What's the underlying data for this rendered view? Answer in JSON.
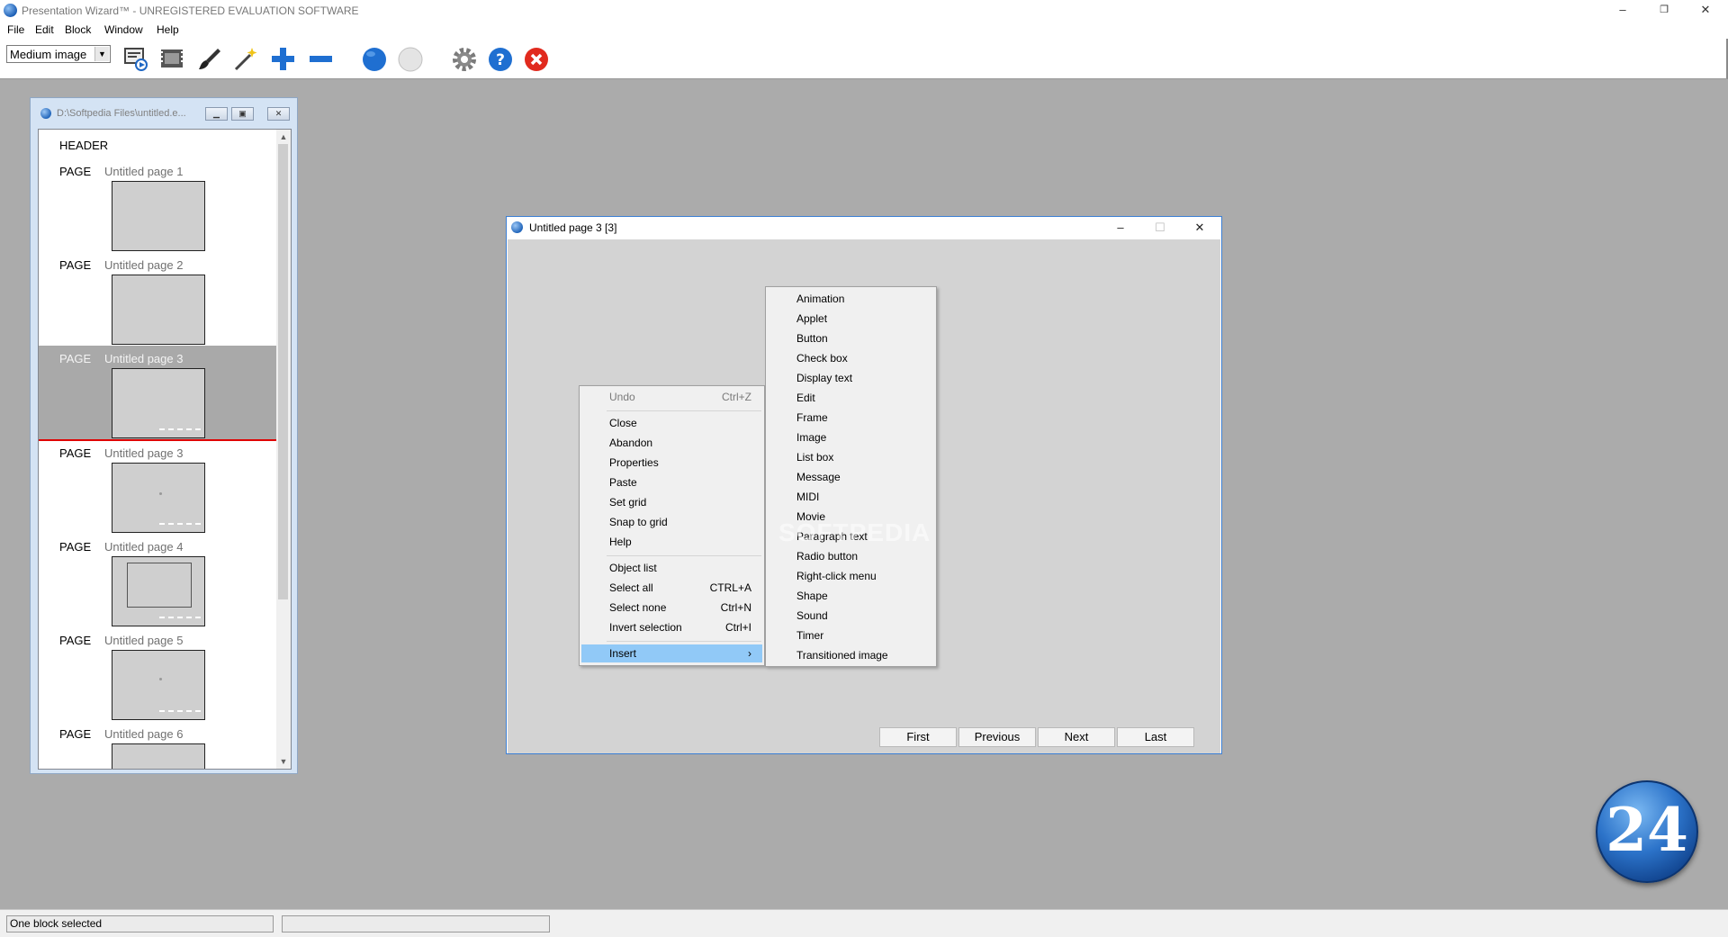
{
  "app": {
    "title": "Presentation Wizard™ - UNREGISTERED EVALUATION SOFTWARE",
    "window_controls": {
      "minimize": "–",
      "restore": "❐",
      "close": "✕"
    }
  },
  "menubar": [
    "File",
    "Edit",
    "Block",
    "Window",
    "Help"
  ],
  "toolbar": {
    "image_size_select": "Medium image",
    "buttons": [
      "slideshow-icon",
      "filmstrip-icon",
      "brush-icon",
      "magic-wand-icon",
      "plus-icon",
      "minus-icon",
      "blue-circle-icon",
      "white-circle-icon",
      "gear-icon",
      "help-icon",
      "close-icon"
    ]
  },
  "document_window": {
    "title": "D:\\Softpedia Files\\untitled.e...",
    "header_label": "HEADER",
    "page_label": "PAGE",
    "pages": [
      {
        "title": "Untitled page 1",
        "thumb": "photo-leaves"
      },
      {
        "title": "Untitled page 2",
        "thumb": "photo-frost"
      },
      {
        "title": "Untitled page 3",
        "thumb": "blank",
        "selected": true
      },
      {
        "title": "Untitled page 3",
        "thumb": "dot"
      },
      {
        "title": "Untitled page 4",
        "thumb": "frame"
      },
      {
        "title": "Untitled page 5",
        "thumb": "dot"
      },
      {
        "title": "Untitled page 6",
        "thumb": "dot"
      }
    ]
  },
  "page_window": {
    "title": "Untitled page 3   [3]",
    "nav_buttons": [
      "First",
      "Previous",
      "Next",
      "Last"
    ]
  },
  "context_menu": [
    {
      "label": "Undo",
      "shortcut": "Ctrl+Z",
      "disabled": true
    },
    {
      "label": "Close"
    },
    {
      "label": "Abandon"
    },
    {
      "label": "Properties"
    },
    {
      "label": "Paste"
    },
    {
      "label": "Set grid"
    },
    {
      "label": "Snap to grid"
    },
    {
      "label": "Help"
    },
    {
      "label": "Object list"
    },
    {
      "label": "Select all",
      "shortcut": "CTRL+A"
    },
    {
      "label": "Select none",
      "shortcut": "Ctrl+N"
    },
    {
      "label": "Invert selection",
      "shortcut": "Ctrl+I"
    },
    {
      "label": "Insert",
      "shortcut": "›",
      "active": true
    }
  ],
  "insert_submenu": [
    "Animation",
    "Applet",
    "Button",
    "Check box",
    "Display text",
    "Edit",
    "Frame",
    "Image",
    "List box",
    "Message",
    "MIDI",
    "Movie",
    "Paragraph text",
    "Radio button",
    "Right-click menu",
    "Shape",
    "Sound",
    "Timer",
    "Transitioned image"
  ],
  "watermark": "SOFTPEDIA",
  "logo_text": "24",
  "status": {
    "pane1": "One block selected",
    "pane2": ""
  },
  "colors": {
    "accent": "#1e6fd0",
    "selection": "#91c9f7",
    "selected_row": "#a9a9a9",
    "desktop": "#ababab"
  }
}
